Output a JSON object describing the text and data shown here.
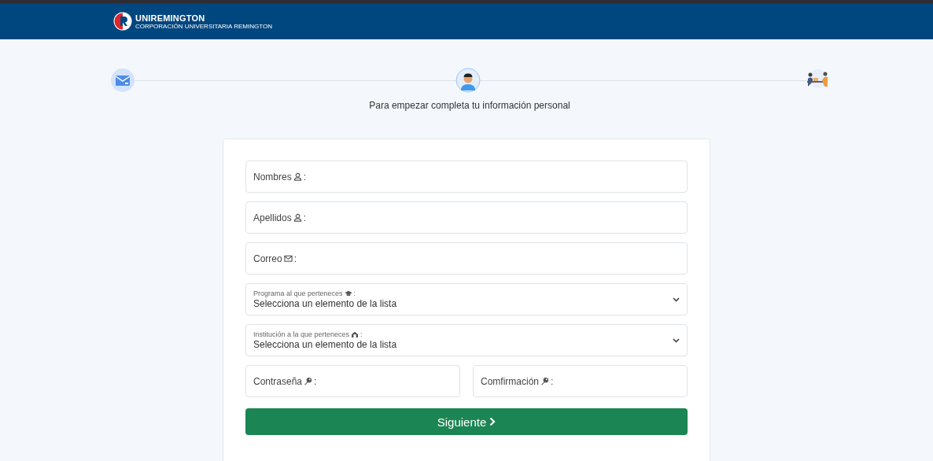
{
  "header": {
    "logo_name": "UNIREMINGTON",
    "logo_subtitle": "CORPORACIÓN UNIVERSITARIA REMINGTON"
  },
  "steps": [
    {
      "kind": "mail",
      "selected": false
    },
    {
      "kind": "person",
      "selected": true
    },
    {
      "kind": "meeting",
      "selected": false
    }
  ],
  "instruction": "Para empezar completa tu información personal",
  "form": {
    "fields": [
      {
        "kind": "text",
        "label": "Nombres",
        "suffix": ":"
      },
      {
        "kind": "text",
        "label": "Apellidos",
        "suffix": ":"
      },
      {
        "kind": "text",
        "label": "Correo",
        "suffix": ":"
      },
      {
        "kind": "select",
        "label": "Programa al que perteneces",
        "suffix": ":",
        "value": "Selecciona un elemento de la lista"
      },
      {
        "kind": "select",
        "label": "Institución a la que perteneces",
        "suffix": ":",
        "value": "Selecciona un elemento de la lista"
      }
    ],
    "password_fields": [
      {
        "kind": "text",
        "label": "Contraseña",
        "suffix": ":"
      },
      {
        "kind": "text",
        "label": "Comfirmación",
        "suffix": ":"
      }
    ],
    "submit": "Siguiente"
  }
}
